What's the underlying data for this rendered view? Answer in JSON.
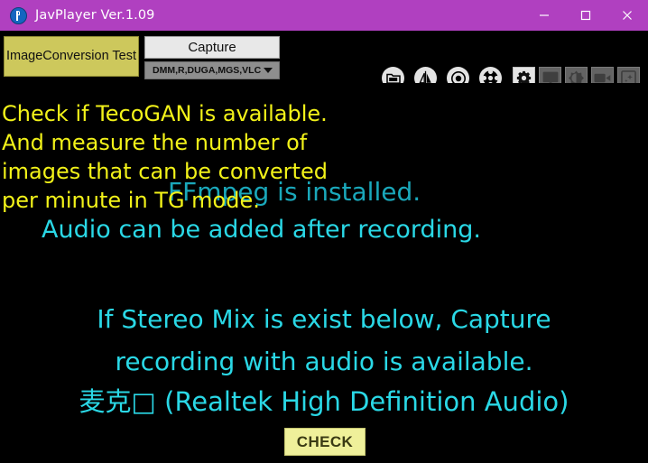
{
  "window": {
    "title": "JavPlayer Ver.1.09",
    "icon": "javplayer-app-icon",
    "controls": {
      "minimize": "minimize-icon",
      "maximize": "maximize-icon",
      "close": "close-icon"
    },
    "titlebar_color": "#b040c0",
    "background_color": "#000000"
  },
  "toolbar": {
    "mode_button_label": "ImageConversion\nTest",
    "mode_button_color": "#cdc85c",
    "capture_button_label": "Capture",
    "capture_select_value": "DMM,R,DUGA,MGS,VLC",
    "round_icons": [
      {
        "name": "folder-icon"
      },
      {
        "name": "flip-mirror-icon"
      },
      {
        "name": "record-icon"
      },
      {
        "name": "disc-icon"
      }
    ],
    "square_icons": [
      {
        "name": "gear-icon",
        "active": true
      },
      {
        "name": "monitor-icon",
        "active": false
      },
      {
        "name": "contrast-icon",
        "active": false
      },
      {
        "name": "video-camera-icon",
        "active": false
      },
      {
        "name": "image-enhance-icon",
        "active": false
      }
    ]
  },
  "main": {
    "ffmpeg_status": "FFmpeg is installed.",
    "task_note": "Check if TecoGAN is available.\nAnd measure the number of\nimages that can be converted\nper minute in TG mode.",
    "audio_note": "Audio can be added after recording.",
    "stereo_mix_note": "If Stereo Mix is exist below, Capture\nrecording with audio is available.",
    "audio_device": "麦克□ (Realtek High Definition Audio)",
    "check_button_label": "CHECK",
    "colors": {
      "yellow_text": "#f2f219",
      "cyan_text": "#2ad8e6",
      "dim_cyan_text": "#1aa8bb",
      "check_button": "#eff09a"
    }
  }
}
